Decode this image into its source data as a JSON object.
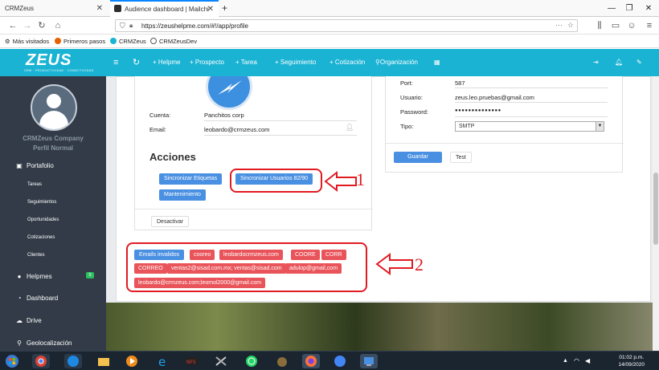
{
  "browser": {
    "tabs": [
      {
        "label": "CRMZeus"
      },
      {
        "label": "Audience dashboard | Mailchi"
      }
    ],
    "new_tab_symbol": "+",
    "url": "https://zeushelpme.com/#!/app/profile",
    "bookmarks": [
      "Más visitados",
      "Primeros pasos",
      "CRMZeus",
      "CRMZeusDev"
    ]
  },
  "app": {
    "logo_word": "ZEUS",
    "logo_tagline": "CRM · PRODUCTIVIDAD · CONECTIVIDAD",
    "nav": [
      "+ Helpme",
      "+ Prospecto",
      "+ Tarea",
      "+ Seguimiento",
      "+ Cotización",
      "Organización"
    ],
    "accent_color": "#1ab3d3"
  },
  "sidebar": {
    "company": "CRMZeus Company",
    "profile": "Perfil Normal",
    "items": [
      {
        "label": "Portafolio",
        "icon": "briefcase-icon"
      },
      {
        "label": "Tareas"
      },
      {
        "label": "Seguimientos"
      },
      {
        "label": "Oportunidades"
      },
      {
        "label": "Cotizaciones"
      },
      {
        "label": "Clientes"
      },
      {
        "label": "Helpmes",
        "icon": "chat-icon",
        "badge": "5"
      },
      {
        "label": "Dashboard",
        "icon": "pie-icon"
      },
      {
        "label": "Drive",
        "icon": "cloud-icon"
      },
      {
        "label": "Geolocalización",
        "icon": "pin-icon"
      }
    ]
  },
  "profile": {
    "cuenta_label": "Cuenta:",
    "cuenta_value": "Panchitos corp",
    "email_label": "Email:",
    "email_value": "leobardo@crmzeus.com",
    "acciones_title": "Acciones",
    "btn_sync_tags": "Sincronizar Etiquetas",
    "btn_sync_users": "Sincronizar Usuarios 82/90",
    "btn_maintenance": "Mantenimiento",
    "btn_deactivate": "Desactivar"
  },
  "smtp": {
    "port_label": "Port:",
    "port_value": "587",
    "user_label": "Usuario:",
    "user_value": "zeus.leo.pruebas@gmail.com",
    "password_label": "Password:",
    "password_value": "●●●●●●●●●●●●●●",
    "type_label": "Tipo:",
    "type_value": "SMTP",
    "btn_save": "Guardar",
    "btn_test": "Test"
  },
  "invalid_emails": {
    "label": "Emails invalidos",
    "items": [
      "cooreo",
      "leobardocrmzeus.com",
      "COORE",
      "CORR",
      "CORREO",
      "ventas2@sisad.com.mx; ventas@sisad.com",
      "adulop@gmail,com",
      "leobardo@crmzeus.com;leomol2000@gmail.com"
    ]
  },
  "annotations": [
    "1",
    "2"
  ],
  "taskbar": {
    "time": "01:02 p.m.",
    "date": "14/09/2020"
  }
}
